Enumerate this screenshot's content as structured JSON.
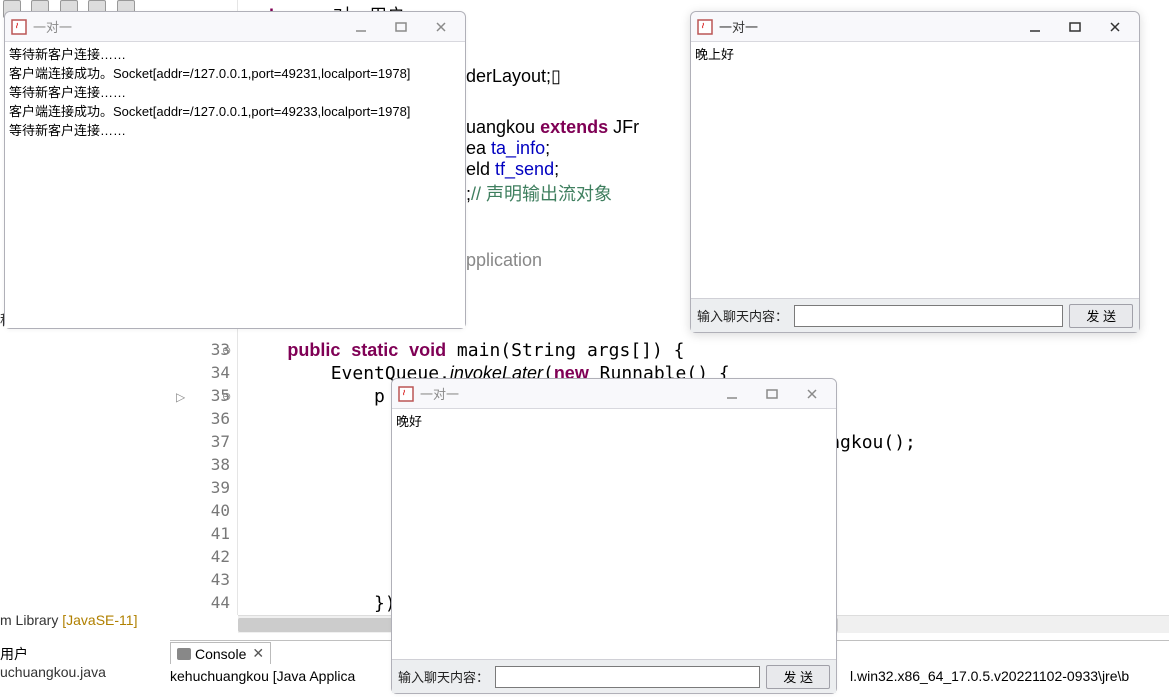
{
  "editor": {
    "package_line": {
      "kw": "package",
      "rest": " 一对一用户;"
    },
    "lines": [
      {
        "num": "33",
        "marker": "⊖",
        "code": "    public static void main(String args[]) {"
      },
      {
        "num": "34",
        "marker": "",
        "code": "        EventQueue.invokeLater(new Runnable() {"
      },
      {
        "num": "35",
        "marker": "⊖",
        "tri": "▷",
        "code": "            p"
      },
      {
        "num": "36",
        "marker": "",
        "code": ""
      },
      {
        "num": "37",
        "marker": "",
        "code": "                                                    uangkou();"
      },
      {
        "num": "38",
        "marker": "",
        "code": ""
      },
      {
        "num": "39",
        "marker": "",
        "code": ""
      },
      {
        "num": "40",
        "marker": "",
        "code": ""
      },
      {
        "num": "41",
        "marker": "",
        "code": ""
      },
      {
        "num": "42",
        "marker": "",
        "code": ""
      },
      {
        "num": "43",
        "marker": "",
        "code": ""
      },
      {
        "num": "44",
        "marker": "",
        "code": "            });"
      }
    ],
    "partial_frags": {
      "l1": "derLayout;▯",
      "l2_pre": "uangkou ",
      "l2_kw": "extends",
      "l2_post": " JFr",
      "l3_pre": "ea ",
      "l3_f": "ta_info",
      "l3_post": ";",
      "l4_pre": "eld ",
      "l4_f": "tf_send",
      "l4_post": ";",
      "l5_pre": ";",
      "l5_cm": "// 声明输出流对象",
      "l6": "pplication"
    }
  },
  "project": {
    "lib_label_prefix": "m Library ",
    "lib_bracket": "[JavaSE-11]",
    "user_label": "用户",
    "file_label": "uchuangkou.java"
  },
  "left_partial": "程",
  "console": {
    "tab": "Console",
    "launched": "kehuchuangkou [Java Applica",
    "jre": "l.win32.x86_64_17.0.5.v20221102-0933\\jre\\b"
  },
  "win_log": {
    "title": "一对一",
    "lines": [
      "等待新客户连接……",
      "客户端连接成功。Socket[addr=/127.0.0.1,port=49231,localport=1978]",
      "等待新客户连接……",
      "客户端连接成功。Socket[addr=/127.0.0.1,port=49233,localport=1978]",
      "等待新客户连接……"
    ]
  },
  "win_right": {
    "title": "一对一",
    "lines": [
      "晚上好"
    ],
    "input_label": "输入聊天内容：",
    "send": "发 送"
  },
  "win_mid": {
    "title": "一对一",
    "lines": [
      "晚好"
    ],
    "input_label": "输入聊天内容：",
    "send": "发 送"
  }
}
